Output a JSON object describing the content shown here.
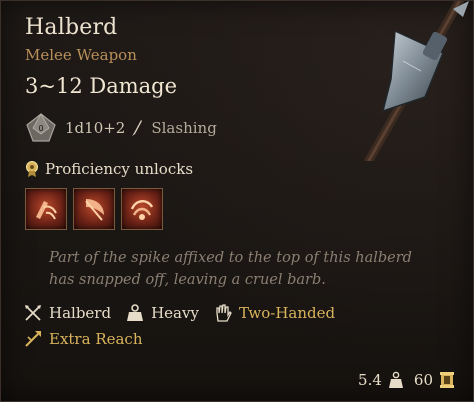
{
  "item": {
    "name": "Halberd",
    "type": "Melee Weapon",
    "damage_range": "3~12 Damage",
    "dice": "1d10+2",
    "damage_type": "Slashing",
    "die_face": "0"
  },
  "proficiency": {
    "label": "Proficiency unlocks",
    "actions": [
      {
        "icon": "lacerate-action-icon"
      },
      {
        "icon": "cleave-action-icon"
      },
      {
        "icon": "brace-action-icon"
      }
    ]
  },
  "flavor_text": "Part of the spike affixed to the top of this halberd has snapped off, leaving a cruel barb.",
  "properties": {
    "proficiency_type": "Halberd",
    "weight_class": "Heavy",
    "handedness": "Two-Handed",
    "extra": "Extra Reach"
  },
  "footer": {
    "weight": "5.4",
    "value": "60"
  },
  "colors": {
    "title": "#ece2cf",
    "subtitle": "#b9905a",
    "gold": "#d9b45c",
    "flavor": "#8a7f72"
  }
}
